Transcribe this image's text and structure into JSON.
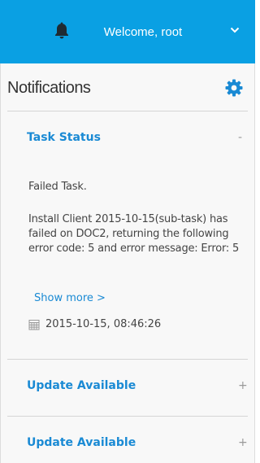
{
  "header": {
    "welcome": "Welcome, root",
    "icon": "bell-icon",
    "dropdown_icon": "chevron-down-icon",
    "background": "#0aa0e3"
  },
  "panel": {
    "title": "Notifications",
    "settings_icon": "gear-icon"
  },
  "task": {
    "title": "Task Status",
    "toggle": "-",
    "summary": "Failed Task.",
    "message": "Install Client 2015-10-15(sub-task) has failed on DOC2, returning the following error code: 5 and error message: Error: 5",
    "show_more": "Show more >",
    "date_icon": "calendar-icon",
    "timestamp": "2015-10-15, 08:46:26"
  },
  "updates": [
    {
      "title": "Update Available",
      "toggle": "+"
    },
    {
      "title": "Update Available",
      "toggle": "+"
    }
  ],
  "colors": {
    "accent": "#1a8ad4",
    "gear": "#1a8ad4"
  }
}
